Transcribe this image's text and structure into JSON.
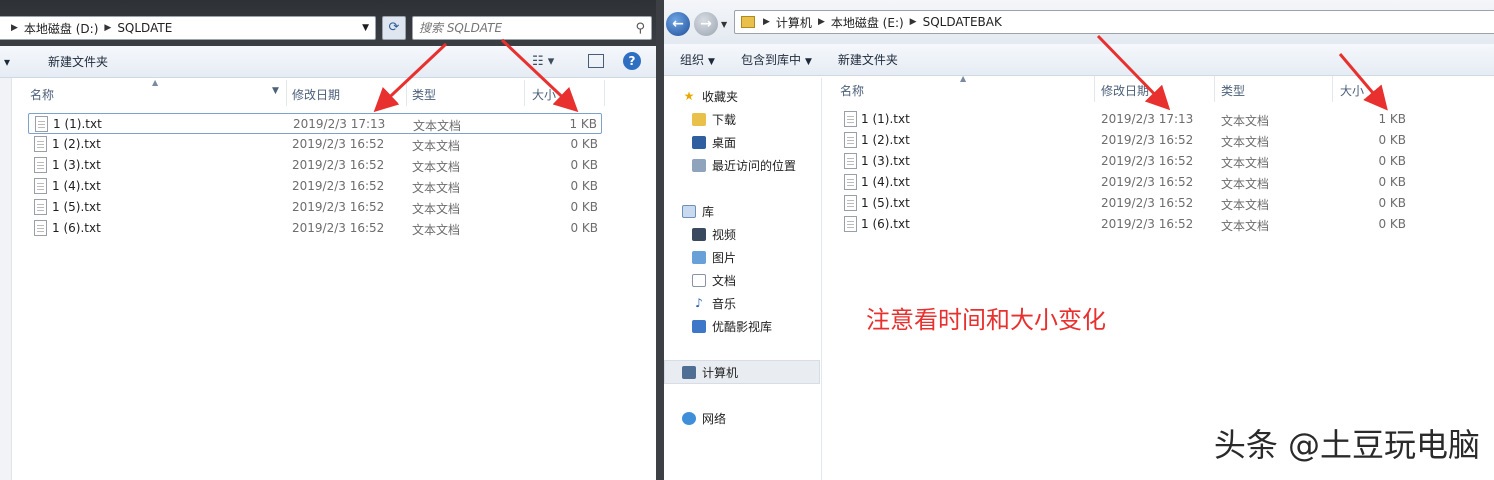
{
  "left": {
    "breadcrumb": [
      "本地磁盘 (D:)",
      "SQLDATE"
    ],
    "search_placeholder": "搜索 SQLDATE",
    "toolbar": {
      "new_folder": "新建文件夹"
    },
    "columns": {
      "name": "名称",
      "date": "修改日期",
      "type": "类型",
      "size": "大小"
    },
    "files": [
      {
        "name": "1 (1).txt",
        "date": "2019/2/3 17:13",
        "type": "文本文档",
        "size": "1 KB"
      },
      {
        "name": "1 (2).txt",
        "date": "2019/2/3 16:52",
        "type": "文本文档",
        "size": "0 KB"
      },
      {
        "name": "1 (3).txt",
        "date": "2019/2/3 16:52",
        "type": "文本文档",
        "size": "0 KB"
      },
      {
        "name": "1 (4).txt",
        "date": "2019/2/3 16:52",
        "type": "文本文档",
        "size": "0 KB"
      },
      {
        "name": "1 (5).txt",
        "date": "2019/2/3 16:52",
        "type": "文本文档",
        "size": "0 KB"
      },
      {
        "name": "1 (6).txt",
        "date": "2019/2/3 16:52",
        "type": "文本文档",
        "size": "0 KB"
      }
    ]
  },
  "right": {
    "breadcrumb": [
      "计算机",
      "本地磁盘 (E:)",
      "SQLDATEBAK"
    ],
    "toolbar": {
      "organize": "组织",
      "include_in_library": "包含到库中",
      "new_folder": "新建文件夹"
    },
    "columns": {
      "name": "名称",
      "date": "修改日期",
      "type": "类型",
      "size": "大小"
    },
    "nav": {
      "favorites": "收藏夹",
      "downloads": "下载",
      "desktop": "桌面",
      "recent": "最近访问的位置",
      "libraries": "库",
      "videos": "视频",
      "pictures": "图片",
      "documents": "文档",
      "music": "音乐",
      "youku": "优酷影视库",
      "computer": "计算机",
      "network": "网络"
    },
    "files": [
      {
        "name": "1 (1).txt",
        "date": "2019/2/3 17:13",
        "type": "文本文档",
        "size": "1 KB"
      },
      {
        "name": "1 (2).txt",
        "date": "2019/2/3 16:52",
        "type": "文本文档",
        "size": "0 KB"
      },
      {
        "name": "1 (3).txt",
        "date": "2019/2/3 16:52",
        "type": "文本文档",
        "size": "0 KB"
      },
      {
        "name": "1 (4).txt",
        "date": "2019/2/3 16:52",
        "type": "文本文档",
        "size": "0 KB"
      },
      {
        "name": "1 (5).txt",
        "date": "2019/2/3 16:52",
        "type": "文本文档",
        "size": "0 KB"
      },
      {
        "name": "1 (6).txt",
        "date": "2019/2/3 16:52",
        "type": "文本文档",
        "size": "0 KB"
      }
    ]
  },
  "annotation": "注意看时间和大小变化",
  "watermark": "头条 @土豆玩电脑",
  "colors": {
    "arrow": "#e8312f",
    "annotation": "#e8312f"
  }
}
